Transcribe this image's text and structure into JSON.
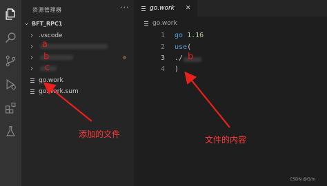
{
  "activity_bar": {
    "icons": [
      "files-icon",
      "search-icon",
      "source-control-icon",
      "run-debug-icon",
      "extensions-icon",
      "testing-icon"
    ]
  },
  "sidebar": {
    "title": "资源管理器",
    "more_actions": "···",
    "folder": "BFT_RPC1",
    "items": [
      {
        "label": ".vscode",
        "kind": "folder"
      },
      {
        "label": "",
        "kind": "folder",
        "marker": "a"
      },
      {
        "label": "",
        "kind": "folder",
        "marker": "b"
      },
      {
        "label": "",
        "kind": "folder",
        "marker": "c"
      },
      {
        "label": "go.work",
        "kind": "file"
      },
      {
        "label": "go.work.sum",
        "kind": "file"
      }
    ]
  },
  "editor": {
    "tab_label": "go.work",
    "breadcrumb": "go.work",
    "lines": [
      {
        "num": "1",
        "keyword": "go",
        "rest": " 1.16"
      },
      {
        "num": "2",
        "keyword": "use",
        "rest": "("
      },
      {
        "num": "3",
        "keyword": "",
        "rest": "./"
      },
      {
        "num": "4",
        "keyword": "",
        "rest": ")"
      }
    ],
    "line3_marker": "b"
  },
  "annotations": {
    "added_files": "添加的文件",
    "file_content": "文件的内容"
  },
  "watermark": "CSDN @G/m",
  "colors": {
    "annotation": "#ff3b3b",
    "keyword": "#569cd6",
    "number": "#b5cea8"
  }
}
